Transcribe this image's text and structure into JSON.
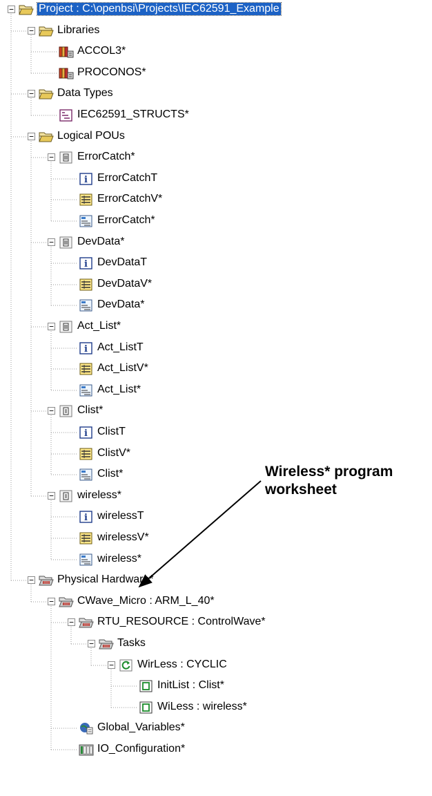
{
  "tree": {
    "nodes": [
      {
        "label": "Project : C:\\openbsi\\Projects\\IEC62591_Example",
        "icon": "open-folder-icon",
        "toggle": "minus",
        "selected": true
      },
      {
        "label": "Libraries",
        "icon": "open-folder-icon",
        "toggle": "minus"
      },
      {
        "label": "ACCOL3*",
        "icon": "library-icon"
      },
      {
        "label": "PROCONOS*",
        "icon": "library-icon"
      },
      {
        "label": "Data Types",
        "icon": "open-folder-icon",
        "toggle": "minus"
      },
      {
        "label": "IEC62591_STRUCTS*",
        "icon": "datatype-icon"
      },
      {
        "label": "Logical POUs",
        "icon": "open-folder-icon",
        "toggle": "minus"
      },
      {
        "label": "ErrorCatch*",
        "icon": "function-block-icon",
        "toggle": "minus"
      },
      {
        "label": "ErrorCatchT",
        "icon": "info-icon"
      },
      {
        "label": "ErrorCatchV*",
        "icon": "variables-icon"
      },
      {
        "label": "ErrorCatch*",
        "icon": "worksheet-icon"
      },
      {
        "label": "DevData*",
        "icon": "function-block-icon",
        "toggle": "minus"
      },
      {
        "label": "DevDataT",
        "icon": "info-icon"
      },
      {
        "label": "DevDataV*",
        "icon": "variables-icon"
      },
      {
        "label": "DevData*",
        "icon": "worksheet-icon"
      },
      {
        "label": "Act_List*",
        "icon": "function-block-icon",
        "toggle": "minus"
      },
      {
        "label": "Act_ListT",
        "icon": "info-icon"
      },
      {
        "label": "Act_ListV*",
        "icon": "variables-icon"
      },
      {
        "label": "Act_List*",
        "icon": "worksheet-icon"
      },
      {
        "label": "Clist*",
        "icon": "program-icon",
        "toggle": "minus"
      },
      {
        "label": "ClistT",
        "icon": "info-icon"
      },
      {
        "label": "ClistV*",
        "icon": "variables-icon"
      },
      {
        "label": "Clist*",
        "icon": "worksheet-icon"
      },
      {
        "label": "wireless*",
        "icon": "program-icon",
        "toggle": "minus"
      },
      {
        "label": "wirelessT",
        "icon": "info-icon"
      },
      {
        "label": "wirelessV*",
        "icon": "variables-icon"
      },
      {
        "label": "wireless*",
        "icon": "worksheet-icon"
      },
      {
        "label": "Physical Hardware*",
        "icon": "hardware-folder-icon",
        "toggle": "minus"
      },
      {
        "label": "CWave_Micro : ARM_L_40*",
        "icon": "hardware-folder-icon",
        "toggle": "minus"
      },
      {
        "label": "RTU_RESOURCE : ControlWave*",
        "icon": "hardware-folder-icon",
        "toggle": "minus"
      },
      {
        "label": "Tasks",
        "icon": "hardware-folder-icon",
        "toggle": "minus"
      },
      {
        "label": "WirLess : CYCLIC",
        "icon": "cyclic-task-icon",
        "toggle": "minus"
      },
      {
        "label": "InitList : Clist*",
        "icon": "program-instance-icon"
      },
      {
        "label": "WiLess : wireless*",
        "icon": "program-instance-icon"
      },
      {
        "label": "Global_Variables*",
        "icon": "global-variables-icon"
      },
      {
        "label": "IO_Configuration*",
        "icon": "io-configuration-icon"
      }
    ]
  },
  "annotation": {
    "line1": "Wireless* program",
    "line2": "worksheet"
  }
}
